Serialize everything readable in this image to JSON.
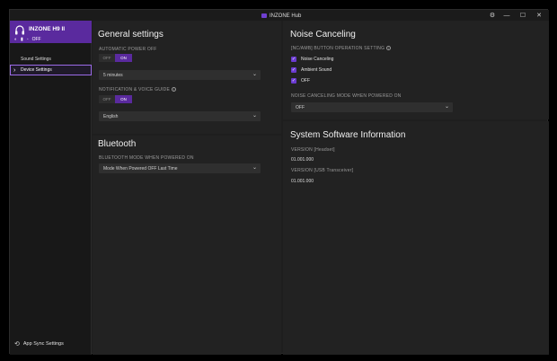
{
  "titlebar": {
    "app_title": "INZONE Hub",
    "settings_icon": "gear-icon",
    "minimize": "—",
    "maximize": "☐",
    "close": "✕"
  },
  "sidebar": {
    "device_name": "INZONE H9 II",
    "device_status_text": "OFF",
    "items": [
      {
        "label": "Sound Settings"
      },
      {
        "label": "Device Settings"
      }
    ],
    "app_sync_label": "App Sync Settings"
  },
  "general": {
    "title": "General settings",
    "auto_power_off_label": "AUTOMATIC POWER OFF",
    "auto_power_off_toggle": {
      "off": "OFF",
      "on": "ON"
    },
    "auto_power_off_value": "5 minutes",
    "notification_label": "NOTIFICATION & VOICE GUIDE",
    "notification_toggle": {
      "off": "OFF",
      "on": "ON"
    },
    "language_value": "English"
  },
  "bluetooth": {
    "title": "Bluetooth",
    "mode_label": "BLUETOOTH MODE WHEN POWERED ON",
    "mode_value": "Mode When Powered OFF Last Time"
  },
  "noise": {
    "title": "Noise Canceling",
    "button_label": "[NC/AMB] BUTTON OPERATION SETTING",
    "options": [
      "Noise Canceling",
      "Ambient Sound",
      "OFF"
    ],
    "mode_label": "NOISE CANCELING MODE WHEN POWERED ON",
    "mode_value": "OFF"
  },
  "system": {
    "title": "System Software Information",
    "headset_label": "VERSION [Headset]",
    "headset_value": "01.001.000",
    "transceiver_label": "VERSION [USB Transceiver]",
    "transceiver_value": "01.001.000"
  },
  "colors": {
    "accent": "#5a2a9e",
    "background": "#1e1e1e",
    "panel": "#222222"
  }
}
